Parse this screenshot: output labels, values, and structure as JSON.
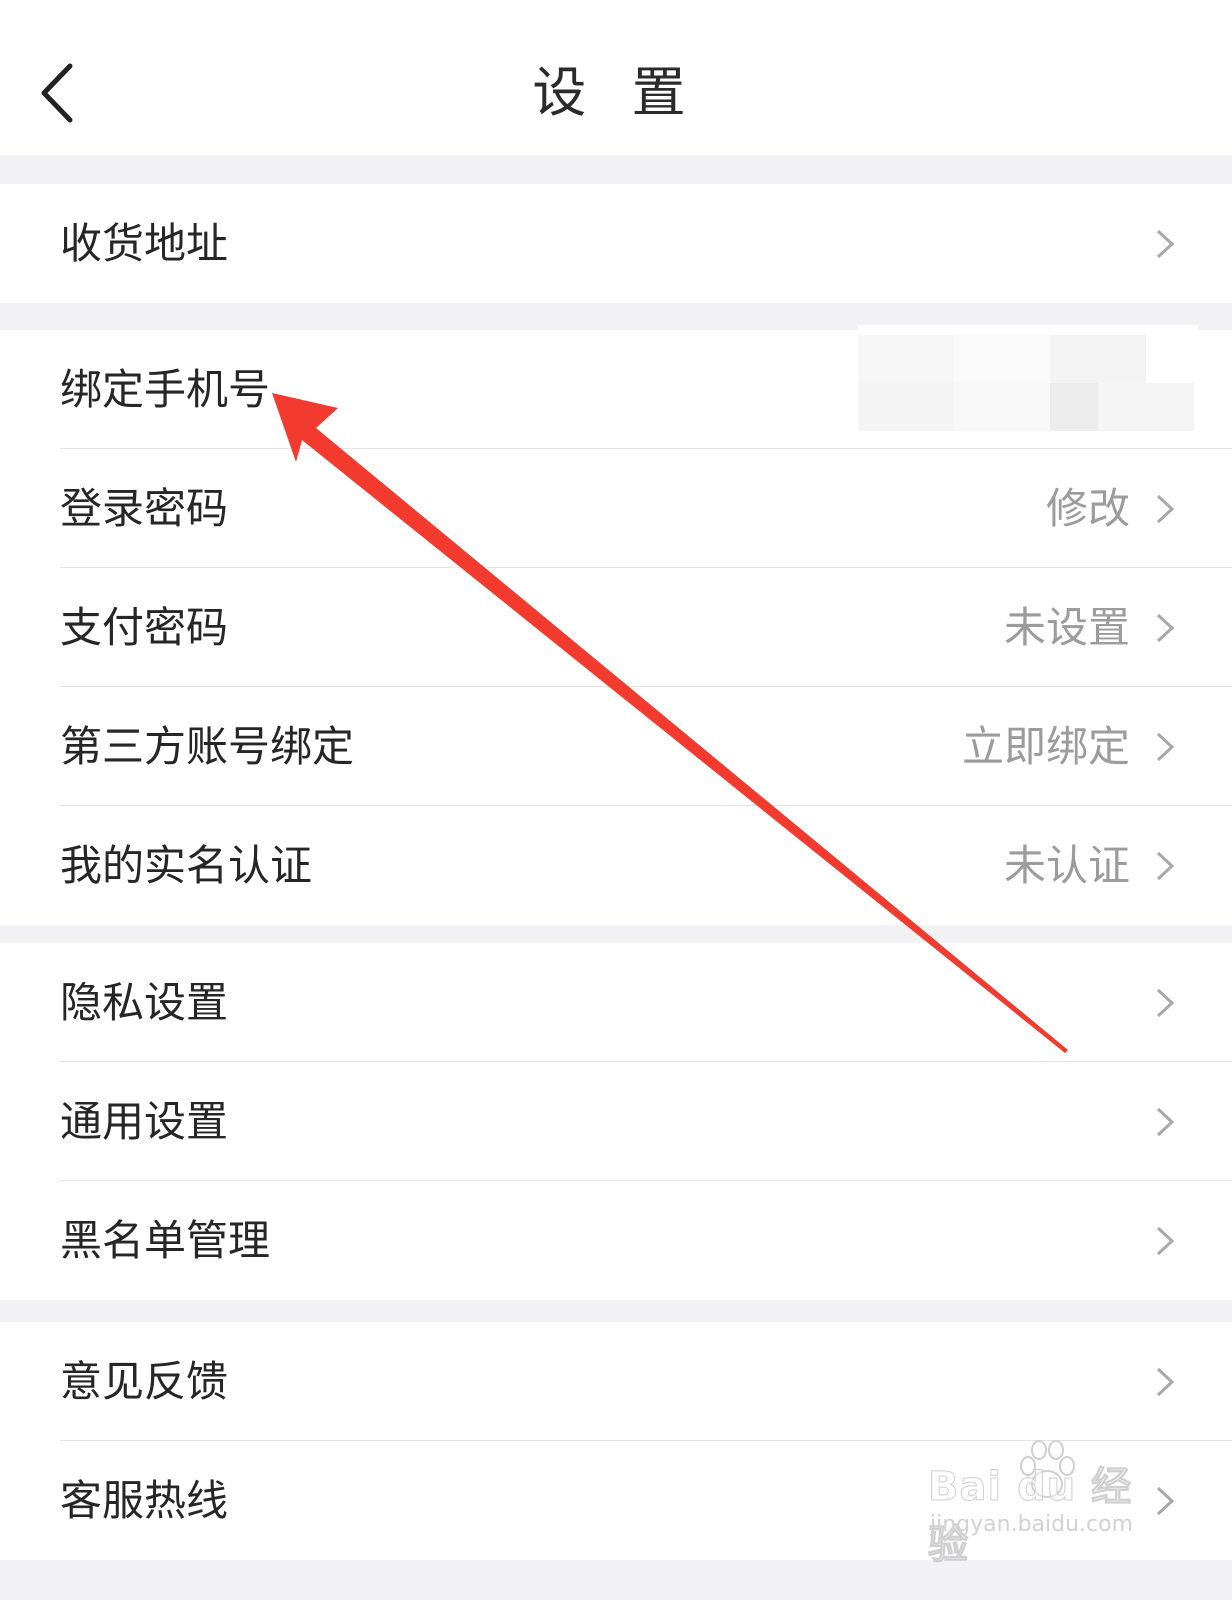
{
  "header": {
    "title": "设 置",
    "back_icon": "chevron-left-icon"
  },
  "groups": [
    {
      "items": [
        {
          "label": "收货地址",
          "value": ""
        }
      ]
    },
    {
      "items": [
        {
          "label": "绑定手机号",
          "value": ""
        },
        {
          "label": "登录密码",
          "value": "修改"
        },
        {
          "label": "支付密码",
          "value": "未设置"
        },
        {
          "label": "第三方账号绑定",
          "value": "立即绑定"
        },
        {
          "label": "我的实名认证",
          "value": "未认证"
        }
      ]
    },
    {
      "items": [
        {
          "label": "隐私设置",
          "value": ""
        },
        {
          "label": "通用设置",
          "value": ""
        },
        {
          "label": "黑名单管理",
          "value": ""
        }
      ]
    },
    {
      "items": [
        {
          "label": "意见反馈",
          "value": ""
        },
        {
          "label": "客服热线",
          "value": ""
        }
      ]
    }
  ],
  "annotation": {
    "arrow_color": "#f23a2e"
  },
  "watermark": {
    "main": "Bai du 经验",
    "url": "jingyan.baidu.com"
  },
  "colors": {
    "background": "#f2f2f4",
    "row": "#ffffff",
    "value_text": "#9c9c9c"
  }
}
